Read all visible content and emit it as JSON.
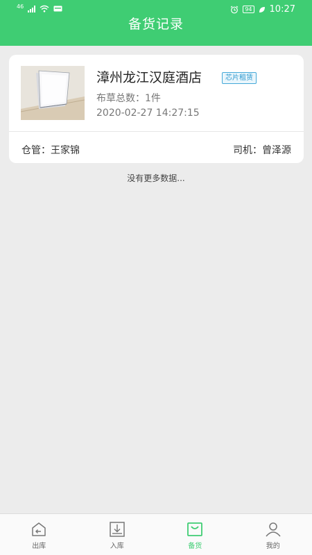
{
  "status_bar": {
    "network_tag": "46",
    "battery_level": "94",
    "time": "10:27"
  },
  "header": {
    "title": "备货记录"
  },
  "record": {
    "hotel_name": "漳州龙江汉庭酒店",
    "tag": "芯片租赁",
    "count_text": "布草总数：1件",
    "datetime": "2020-02-27 14:27:15",
    "keeper_text": "仓管：王家锦",
    "driver_text": "司机：曾泽源",
    "image_icon": "pillow-photo"
  },
  "list_footer": {
    "text": "没有更多数据..."
  },
  "tabbar": {
    "active_color": "#3fcd73",
    "items": [
      {
        "label": "出库",
        "icon": "outbound-icon"
      },
      {
        "label": "入库",
        "icon": "inbound-icon"
      },
      {
        "label": "备货",
        "icon": "stock-bag-icon"
      },
      {
        "label": "我的",
        "icon": "user-icon"
      }
    ]
  }
}
